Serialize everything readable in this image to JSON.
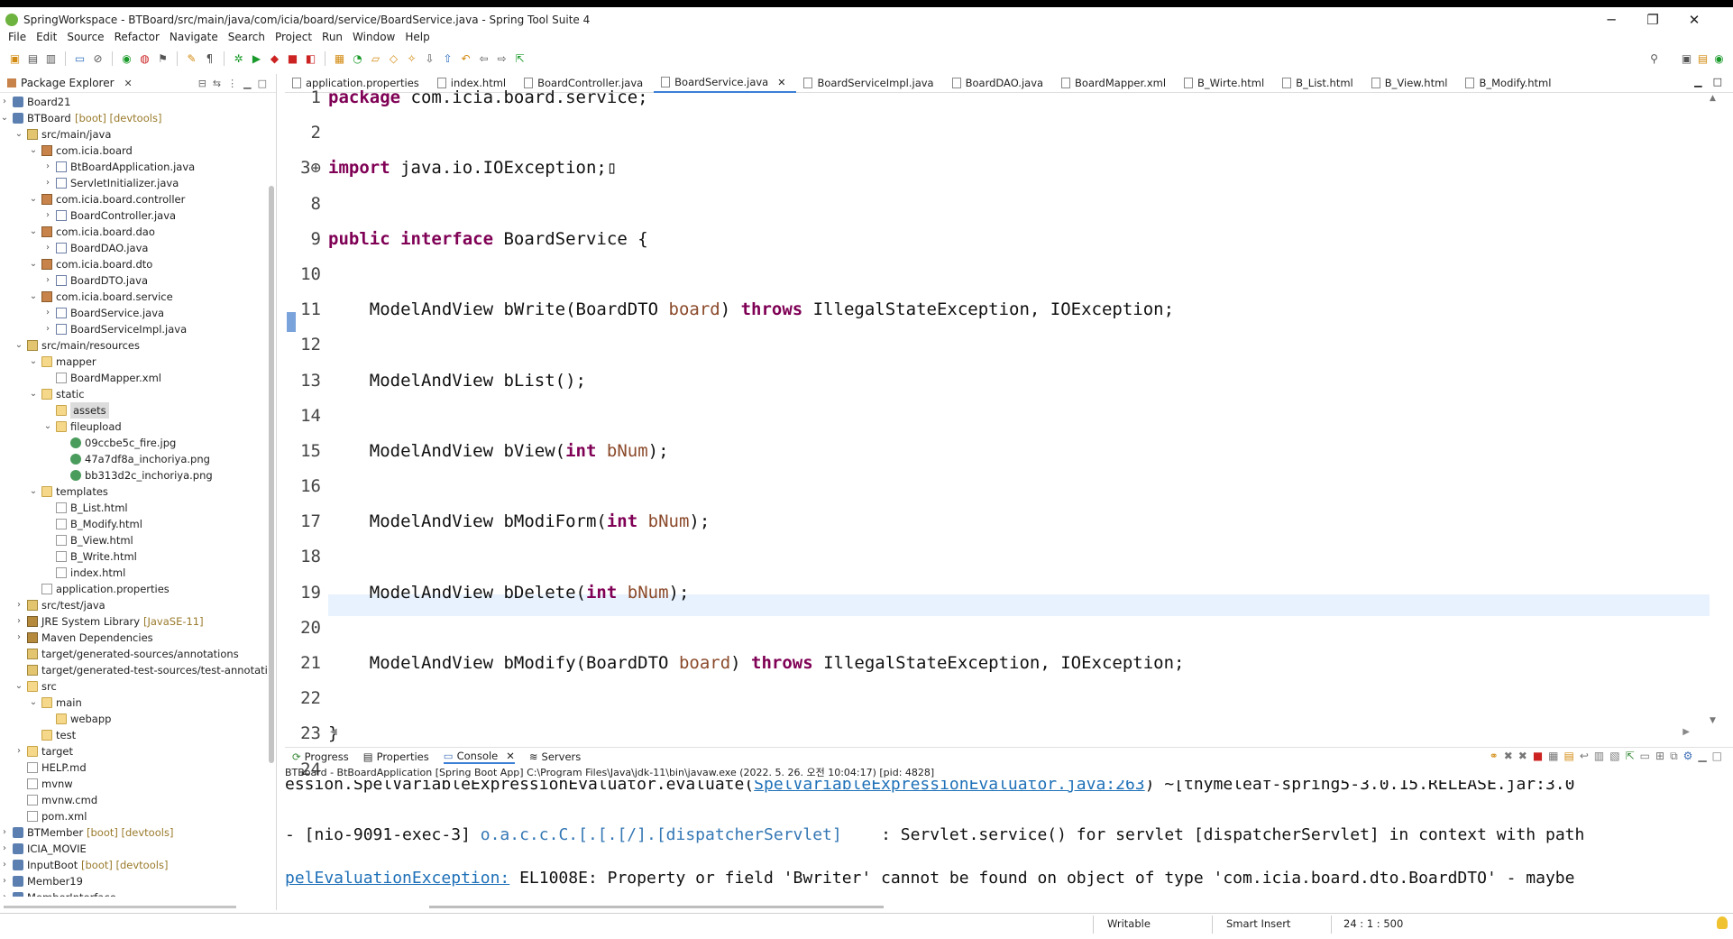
{
  "window": {
    "title": "SpringWorkspace - BTBoard/src/main/java/com/icia/board/service/BoardService.java - Spring Tool Suite 4",
    "minimize": "─",
    "maximize": "❐",
    "close": "✕"
  },
  "menu": [
    "File",
    "Edit",
    "Source",
    "Refactor",
    "Navigate",
    "Search",
    "Project",
    "Run",
    "Window",
    "Help"
  ],
  "package_explorer": {
    "title": "Package Explorer",
    "items": [
      {
        "label": "Board21",
        "depth": 0,
        "chev": ">",
        "icon": "project"
      },
      {
        "label": "BTBoard",
        "deco": "[boot] [devtools]",
        "depth": 0,
        "chev": "v",
        "icon": "project"
      },
      {
        "label": "src/main/java",
        "depth": 1,
        "chev": "v",
        "icon": "src"
      },
      {
        "label": "com.icia.board",
        "depth": 2,
        "chev": "v",
        "icon": "pkg"
      },
      {
        "label": "BtBoardApplication.java",
        "depth": 3,
        "chev": ">",
        "icon": "java"
      },
      {
        "label": "ServletInitializer.java",
        "depth": 3,
        "chev": ">",
        "icon": "java"
      },
      {
        "label": "com.icia.board.controller",
        "depth": 2,
        "chev": "v",
        "icon": "pkg"
      },
      {
        "label": "BoardController.java",
        "depth": 3,
        "chev": ">",
        "icon": "java"
      },
      {
        "label": "com.icia.board.dao",
        "depth": 2,
        "chev": "v",
        "icon": "pkg"
      },
      {
        "label": "BoardDAO.java",
        "depth": 3,
        "chev": ">",
        "icon": "java"
      },
      {
        "label": "com.icia.board.dto",
        "depth": 2,
        "chev": "v",
        "icon": "pkg"
      },
      {
        "label": "BoardDTO.java",
        "depth": 3,
        "chev": ">",
        "icon": "java"
      },
      {
        "label": "com.icia.board.service",
        "depth": 2,
        "chev": "v",
        "icon": "pkg"
      },
      {
        "label": "BoardService.java",
        "depth": 3,
        "chev": ">",
        "icon": "java"
      },
      {
        "label": "BoardServiceImpl.java",
        "depth": 3,
        "chev": ">",
        "icon": "java"
      },
      {
        "label": "src/main/resources",
        "depth": 1,
        "chev": "v",
        "icon": "src"
      },
      {
        "label": "mapper",
        "depth": 2,
        "chev": "v",
        "icon": "folder"
      },
      {
        "label": "BoardMapper.xml",
        "depth": 3,
        "chev": "",
        "icon": "file"
      },
      {
        "label": "static",
        "depth": 2,
        "chev": "v",
        "icon": "folder"
      },
      {
        "label": "assets",
        "depth": 3,
        "chev": "",
        "icon": "folder",
        "selected": true
      },
      {
        "label": "fileupload",
        "depth": 3,
        "chev": "v",
        "icon": "folder"
      },
      {
        "label": "09ccbe5c_fire.jpg",
        "depth": 4,
        "chev": "",
        "icon": "img"
      },
      {
        "label": "47a7df8a_inchoriya.png",
        "depth": 4,
        "chev": "",
        "icon": "img"
      },
      {
        "label": "bb313d2c_inchoriya.png",
        "depth": 4,
        "chev": "",
        "icon": "img"
      },
      {
        "label": "templates",
        "depth": 2,
        "chev": "v",
        "icon": "folder"
      },
      {
        "label": "B_List.html",
        "depth": 3,
        "chev": "",
        "icon": "file"
      },
      {
        "label": "B_Modify.html",
        "depth": 3,
        "chev": "",
        "icon": "file"
      },
      {
        "label": "B_View.html",
        "depth": 3,
        "chev": "",
        "icon": "file"
      },
      {
        "label": "B_Write.html",
        "depth": 3,
        "chev": "",
        "icon": "file"
      },
      {
        "label": "index.html",
        "depth": 3,
        "chev": "",
        "icon": "file"
      },
      {
        "label": "application.properties",
        "depth": 2,
        "chev": "",
        "icon": "file"
      },
      {
        "label": "src/test/java",
        "depth": 1,
        "chev": ">",
        "icon": "src"
      },
      {
        "label": "JRE System Library",
        "deco": "[JavaSE-11]",
        "depth": 1,
        "chev": ">",
        "icon": "lib"
      },
      {
        "label": "Maven Dependencies",
        "depth": 1,
        "chev": ">",
        "icon": "lib"
      },
      {
        "label": "target/generated-sources/annotations",
        "depth": 1,
        "chev": "",
        "icon": "src"
      },
      {
        "label": "target/generated-test-sources/test-annotatic",
        "depth": 1,
        "chev": "",
        "icon": "src"
      },
      {
        "label": "src",
        "depth": 1,
        "chev": "v",
        "icon": "folder"
      },
      {
        "label": "main",
        "depth": 2,
        "chev": "v",
        "icon": "folder"
      },
      {
        "label": "webapp",
        "depth": 3,
        "chev": "",
        "icon": "folder"
      },
      {
        "label": "test",
        "depth": 2,
        "chev": "",
        "icon": "folder"
      },
      {
        "label": "target",
        "depth": 1,
        "chev": ">",
        "icon": "folder"
      },
      {
        "label": "HELP.md",
        "depth": 1,
        "chev": "",
        "icon": "file"
      },
      {
        "label": "mvnw",
        "depth": 1,
        "chev": "",
        "icon": "file"
      },
      {
        "label": "mvnw.cmd",
        "depth": 1,
        "chev": "",
        "icon": "file"
      },
      {
        "label": "pom.xml",
        "depth": 1,
        "chev": "",
        "icon": "file"
      },
      {
        "label": "BTMember",
        "deco": "[boot] [devtools]",
        "depth": 0,
        "chev": ">",
        "icon": "project"
      },
      {
        "label": "ICIA_MOVIE",
        "depth": 0,
        "chev": ">",
        "icon": "project"
      },
      {
        "label": "InputBoot",
        "deco": "[boot] [devtools]",
        "depth": 0,
        "chev": ">",
        "icon": "project"
      },
      {
        "label": "Member19",
        "depth": 0,
        "chev": ">",
        "icon": "project"
      },
      {
        "label": "MemberInterface",
        "depth": 0,
        "chev": ">",
        "icon": "project"
      }
    ]
  },
  "editor_tabs": [
    {
      "label": "application.properties"
    },
    {
      "label": "index.html"
    },
    {
      "label": "BoardController.java"
    },
    {
      "label": "BoardService.java",
      "active": true
    },
    {
      "label": "BoardServiceImpl.java"
    },
    {
      "label": "BoardDAO.java"
    },
    {
      "label": "BoardMapper.xml"
    },
    {
      "label": "B_Wirte.html"
    },
    {
      "label": "B_List.html"
    },
    {
      "label": "B_View.html"
    },
    {
      "label": "B_Modify.html"
    }
  ],
  "code_lines": [
    {
      "num": "1",
      "html": "<span class=\"kw\">package</span> com.icia.board.service;"
    },
    {
      "num": "2",
      "html": ""
    },
    {
      "num": "3⊕",
      "html": "<span class=\"kw\">import</span> java.io.IOException;▯"
    },
    {
      "num": "8",
      "html": ""
    },
    {
      "num": "9",
      "html": "<span class=\"kw\">public</span> <span class=\"kw\">interface</span> BoardService {"
    },
    {
      "num": "10",
      "html": ""
    },
    {
      "num": "11",
      "html": "    ModelAndView bWrite(BoardDTO <span class=\"param\">board</span>) <span class=\"kw\">throws</span> IllegalStateException, IOException;"
    },
    {
      "num": "12",
      "html": ""
    },
    {
      "num": "13",
      "html": "    ModelAndView bList();"
    },
    {
      "num": "14",
      "html": ""
    },
    {
      "num": "15",
      "html": "    ModelAndView bView(<span class=\"kw\">int</span> <span class=\"param\">bNum</span>);"
    },
    {
      "num": "16",
      "html": ""
    },
    {
      "num": "17",
      "html": "    ModelAndView bModiForm(<span class=\"kw\">int</span> <span class=\"param\">bNum</span>);"
    },
    {
      "num": "18",
      "html": ""
    },
    {
      "num": "19",
      "html": "    ModelAndView bDelete(<span class=\"kw\">int</span> <span class=\"param\">bNum</span>);"
    },
    {
      "num": "20",
      "html": ""
    },
    {
      "num": "21",
      "html": "    ModelAndView bModify(BoardDTO <span class=\"param\">board</span>) <span class=\"kw\">throws</span> IllegalStateException, IOException;"
    },
    {
      "num": "22",
      "html": ""
    },
    {
      "num": "23",
      "html": "}"
    },
    {
      "num": "24",
      "html": ""
    }
  ],
  "bottom_tabs": [
    {
      "label": "Progress"
    },
    {
      "label": "Properties"
    },
    {
      "label": "Console",
      "active": true
    },
    {
      "label": "Servers"
    }
  ],
  "console": {
    "description": "BTBoard - BtBoardApplication [Spring Boot App] C:\\Program Files\\Java\\jdk-11\\bin\\javaw.exe  (2022. 5. 26. 오전 10:04:17) [pid: 4828]",
    "line1_pre": "ession.SpelVariableExpressionEvaluator.evaluate(",
    "line1_link": "SpelVariableExpressionEvaluator.java:263",
    "line1_post": ") ~[thymeleaf-spring5-3.0.15.RELEASE.jar:3.0",
    "line2_pre": "- [nio-9091-exec-3] ",
    "line2_logger": "o.a.c.c.C.[.[.[/].[dispatcherServlet]",
    "line2_post": "    : Servlet.service() for servlet [dispatcherServlet] in context with path",
    "line3_link": "pelEvaluationException:",
    "line3_post": " EL1008E: Property or field 'Bwriter' cannot be found on object of type 'com.icia.board.dto.BoardDTO' - maybe"
  },
  "status": {
    "writable": "Writable",
    "insert_mode": "Smart Insert",
    "position": "24 : 1 : 500"
  }
}
